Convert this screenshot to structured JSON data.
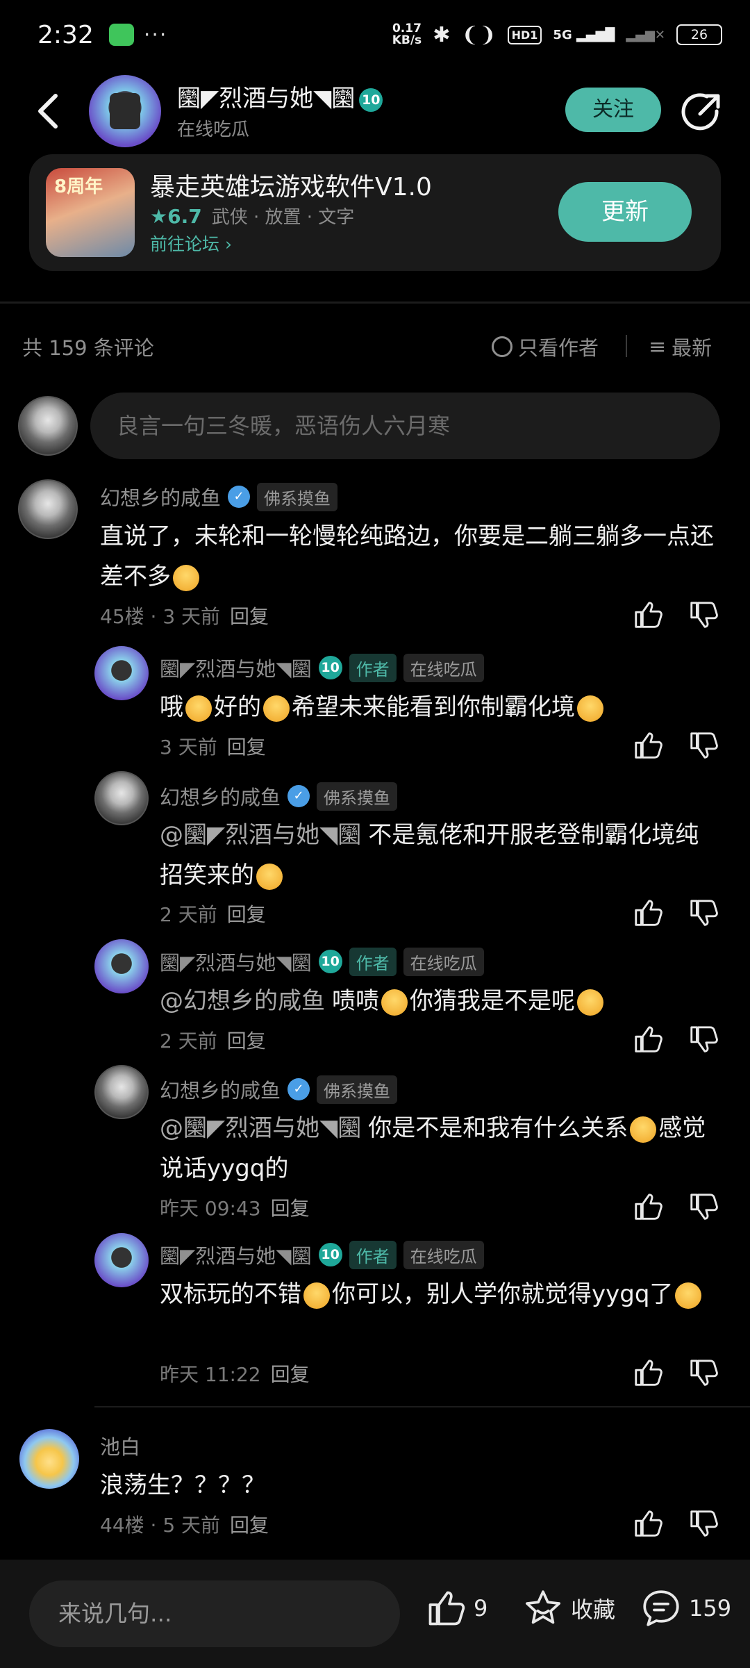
{
  "status_bar": {
    "time": "2:32",
    "net_speed_value": "0.17",
    "net_speed_unit": "KB/s",
    "hd_label": "HD1",
    "signal_label": "5G",
    "battery": "26"
  },
  "header": {
    "name": "圞◤烈酒与她◥圞",
    "level": "10",
    "subtitle": "在线吃瓜",
    "follow_label": "关注"
  },
  "app_card": {
    "icon_badge": "8周年",
    "title": "暴走英雄坛游戏软件V1.0",
    "rating": "★6.7",
    "tags": "武侠 · 放置 · 文字",
    "link_label": "前往论坛 ›",
    "update_label": "更新"
  },
  "comments_bar": {
    "count_label": "共 159 条评论",
    "author_only_label": "只看作者",
    "sort_label": "最新"
  },
  "compose": {
    "placeholder": "良言一句三冬暖，恶语伤人六月寒"
  },
  "comments": [
    {
      "name": "幻想乡的咸鱼",
      "badge": "佛系摸鱼",
      "text_a": "直说了，未轮和一轮慢轮纯路边，你要是二躺三躺多一点还差不多",
      "meta": "45楼 · 3 天前",
      "reply_label": "回复",
      "replies": [
        {
          "name": "圞◤烈酒与她◥圞",
          "level": "10",
          "author_tag": "作者",
          "badge": "在线吃瓜",
          "text_a": "哦",
          "text_b": "好的",
          "text_c": "希望未来能看到你制霸化境",
          "meta": "3 天前",
          "reply_label": "回复"
        },
        {
          "name": "幻想乡的咸鱼",
          "badge": "佛系摸鱼",
          "mention": "@圞◤烈酒与她◥圞",
          "text_a": "不是氪佬和开服老登制霸化境纯招笑来的",
          "meta": "2 天前",
          "reply_label": "回复"
        },
        {
          "name": "圞◤烈酒与她◥圞",
          "level": "10",
          "author_tag": "作者",
          "badge": "在线吃瓜",
          "mention": "@幻想乡的咸鱼",
          "text_a": "啧啧",
          "text_b": "你猜我是不是呢",
          "meta": "2 天前",
          "reply_label": "回复"
        },
        {
          "name": "幻想乡的咸鱼",
          "badge": "佛系摸鱼",
          "mention": "@圞◤烈酒与她◥圞",
          "text_a": "你是不是和我有什么关系",
          "text_b": "感觉说话yygq的",
          "meta": "昨天 09:43",
          "reply_label": "回复"
        },
        {
          "name": "圞◤烈酒与她◥圞",
          "level": "10",
          "author_tag": "作者",
          "badge": "在线吃瓜",
          "text_a": "双标玩的不错",
          "text_b": "你可以，别人学你就觉得yygq了",
          "meta": "昨天 11:22",
          "reply_label": "回复"
        }
      ]
    },
    {
      "name": "池白",
      "text_a": "浪荡生？？？？",
      "meta": "44楼 · 5 天前",
      "reply_label": "回复"
    }
  ],
  "bottom_bar": {
    "input_placeholder": "来说几句...",
    "like_count": "9",
    "favorite_label": "收藏",
    "comment_count": "159"
  },
  "colors": {
    "accent": "#4eb9a8",
    "background": "#000000",
    "card": "#1a1a1a"
  },
  "icons": [
    "back-arrow-icon",
    "share-icon",
    "thumbs-up-icon",
    "thumbs-down-icon",
    "star-icon",
    "comment-icon",
    "sort-icon",
    "verified-badge-icon",
    "wechat-icon",
    "bluetooth-icon"
  ]
}
